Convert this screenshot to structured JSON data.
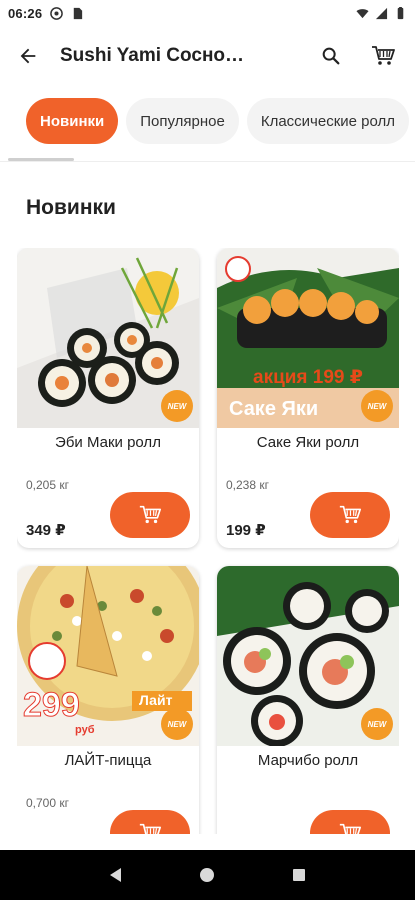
{
  "status_bar": {
    "time": "06:26",
    "icons": [
      "notification-icon",
      "sim-icon",
      "wifi-icon",
      "signal-icon",
      "battery-icon"
    ]
  },
  "app_bar": {
    "title": "Sushi Yami Сосно…",
    "back_icon": "arrow-left-icon",
    "search_icon": "search-icon",
    "cart_icon": "cart-icon"
  },
  "categories": [
    {
      "label": "Новинки",
      "active": true
    },
    {
      "label": "Популярное",
      "active": false
    },
    {
      "label": "Классические ролл",
      "active": false
    }
  ],
  "section": {
    "title": "Новинки"
  },
  "products": [
    {
      "name": "Эби Маки ролл",
      "weight": "0,205 кг",
      "price": "349 ₽",
      "badge": "NEW"
    },
    {
      "name": "Саке Яки ролл",
      "weight": "0,238 кг",
      "price": "199 ₽",
      "badge": "NEW",
      "image_text": [
        "акция 199 ₽",
        "Саке Яки"
      ]
    },
    {
      "name": "ЛАЙТ-пицца",
      "weight": "0,700 кг",
      "price": "",
      "badge": "NEW",
      "image_text": [
        "299",
        "руб",
        "Лайт"
      ]
    },
    {
      "name": "Марчибо ролл",
      "weight": "",
      "price": "",
      "badge": "NEW"
    }
  ],
  "colors": {
    "accent": "#f0622a",
    "badge": "#f39a26"
  }
}
